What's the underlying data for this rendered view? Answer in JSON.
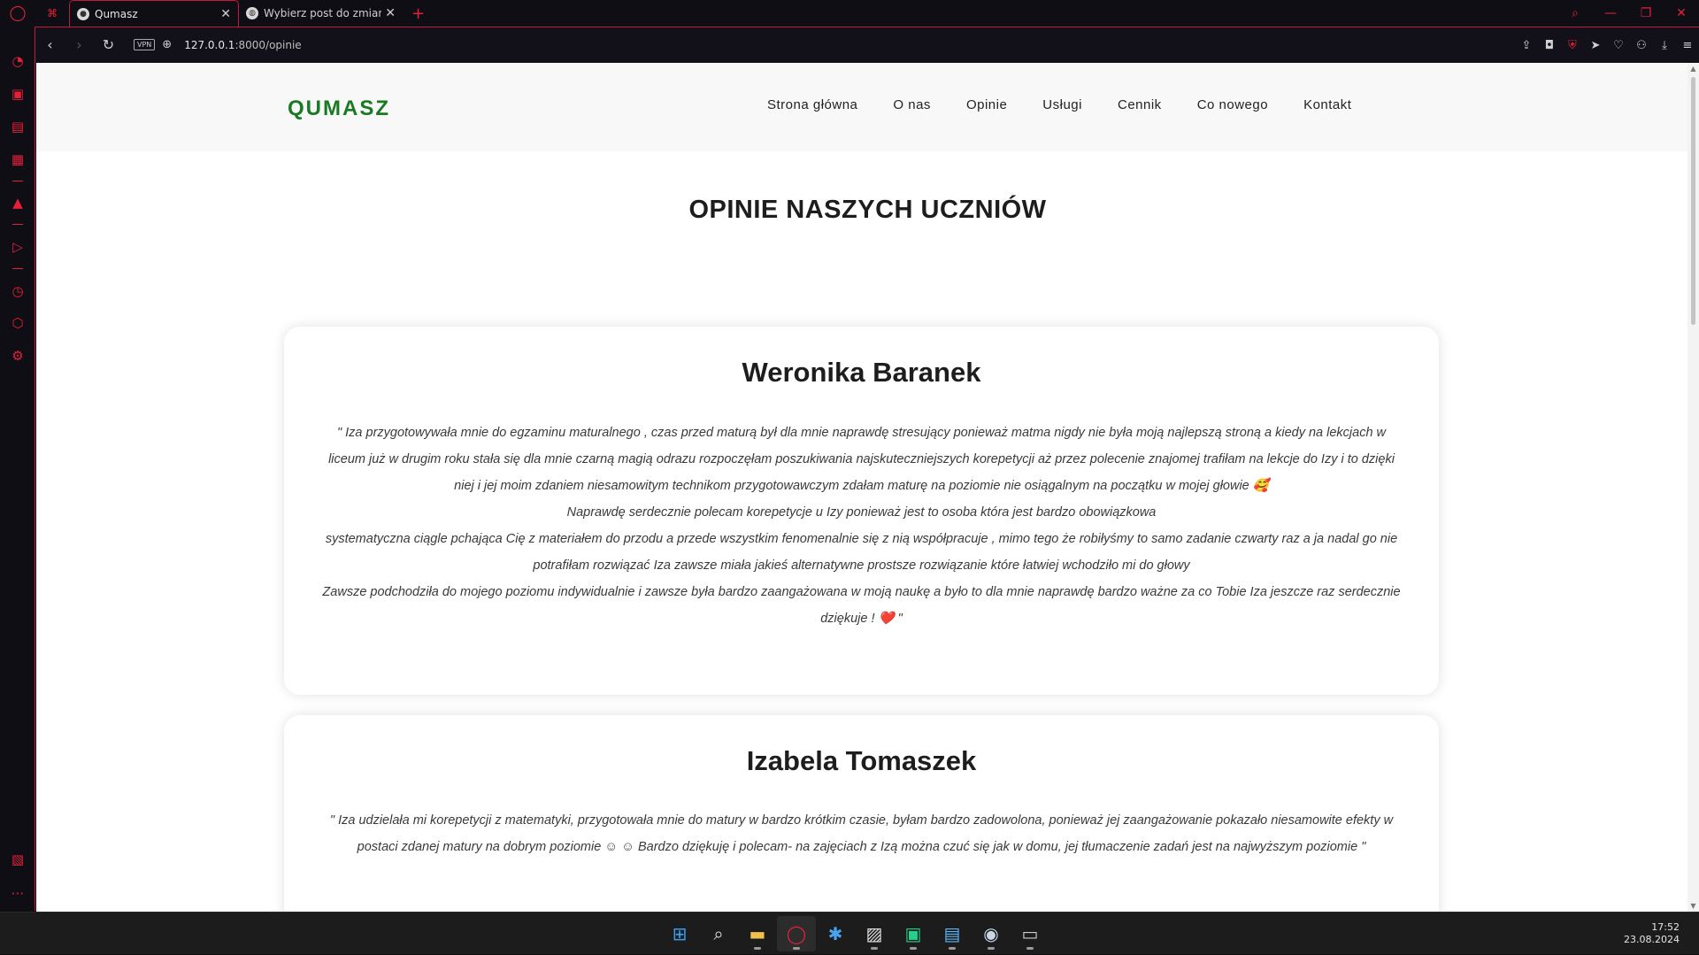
{
  "browser": {
    "tabs": [
      {
        "title": "Qumasz",
        "active": true
      },
      {
        "title": "Wybierz post do zmiany | A",
        "active": false
      }
    ],
    "url_host": "127.0.0.1",
    "url_path": ":8000/opinie",
    "vpn_label": "VPN",
    "accent_color": "#e5203a"
  },
  "site": {
    "logo": "QUMASZ",
    "menu": [
      "Strona główna",
      "O nas",
      "Opinie",
      "Usługi",
      "Cennik",
      "Co nowego",
      "Kontakt"
    ],
    "page_title": "OPINIE NASZYCH UCZNIÓW",
    "brand_color": "#197a23"
  },
  "reviews": [
    {
      "name": "Weronika Baranek",
      "lines": [
        "\" Iza przygotowywała mnie do egzaminu maturalnego , czas przed maturą był dla mnie naprawdę stresujący ponieważ matma nigdy nie była moją najlepszą stroną a kiedy na lekcjach w liceum już w drugim roku stała się dla mnie czarną magią odrazu rozpoczęłam poszukiwania najskuteczniejszych korepetycji aż przez polecenie znajomej trafiłam na lekcje do Izy i to dzięki niej i jej moim zdaniem niesamowitym technikom przygotowawczym zdałam maturę na poziomie nie osiągalnym na początku w mojej głowie 🥰",
        "Naprawdę serdecznie polecam korepetycje u Izy ponieważ jest to osoba która jest bardzo obowiązkowa",
        "systematyczna ciągle pchająca Cię z materiałem do przodu a przede wszystkim fenomenalnie się z nią współpracuje , mimo tego że robiłyśmy to samo zadanie czwarty raz a ja nadal go nie potrafiłam rozwiązać Iza zawsze miała jakieś alternatywne prostsze rozwiązanie które łatwiej wchodziło mi do głowy",
        "Zawsze podchodziła do mojego poziomu indywidualnie i zawsze była bardzo zaangażowana w moją naukę a było to dla mnie naprawdę bardzo ważne za co Tobie Iza jeszcze raz serdecznie dziękuje ! ❤️ \""
      ]
    },
    {
      "name": "Izabela Tomaszek",
      "lines": [
        "\" Iza udzielała mi korepetycji z matematyki, przygotowała mnie do matury w bardzo krótkim czasie, byłam bardzo zadowolona, ponieważ jej zaangażowanie pokazało niesamowite efekty w postaci zdanej matury na dobrym poziomie ☺ ☺ Bardzo dziękuję i polecam- na zajęciach z Izą można czuć się jak w domu, jej tłumaczenie zadań jest na najwyższym poziomie \""
      ]
    }
  ],
  "taskbar": {
    "time": "17:52",
    "date": "23.08.2024",
    "icons": [
      "windows-start",
      "search",
      "file-explorer",
      "opera",
      "app-blue",
      "app-paint",
      "pycharm",
      "notepad",
      "steam",
      "terminal"
    ]
  }
}
